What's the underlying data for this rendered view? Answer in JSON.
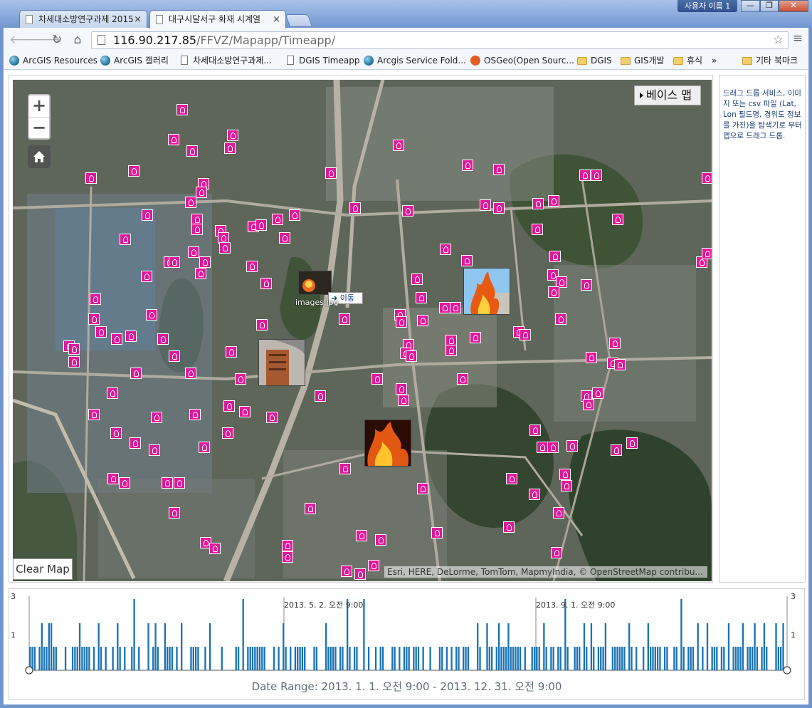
{
  "browser": {
    "tabs": [
      {
        "title": "차세대소방연구과제 2015"
      },
      {
        "title": "대구시달서구 화재 시계열"
      }
    ],
    "user_label": "사용자 이름 1",
    "window_buttons": [
      "—",
      "❐",
      "✕"
    ],
    "url_host": "116.90.217.85",
    "url_path": "/FFVZ/Mapapp/Timeapp/",
    "bookmarks": [
      {
        "label": "ArcGIS Resources",
        "icon": "globe-icon"
      },
      {
        "label": "ArcGIS 갤러리",
        "icon": "globe-icon"
      },
      {
        "label": "차세대소방연구과제...",
        "icon": "page-icon"
      },
      {
        "label": "DGIS Timeapp",
        "icon": "page-icon"
      },
      {
        "label": "Arcgis Service Fold...",
        "icon": "globe-icon"
      },
      {
        "label": "OSGeo(Open Sourc...",
        "icon": "osgeo-icon"
      },
      {
        "label": "DGIS",
        "icon": "folder-icon"
      },
      {
        "label": "GIS개발",
        "icon": "folder-icon"
      },
      {
        "label": "휴식",
        "icon": "folder-icon"
      }
    ],
    "bookmarks_overflow": "»",
    "other_bookmarks": "기타 북마크"
  },
  "map": {
    "zoom_in": "+",
    "zoom_out": "−",
    "basemap_label": "베이스 맵",
    "clear_label": "Clear Map",
    "attribution": "Esri, HERE, DeLorme, TomTom, MapmyIndia, © OpenStreetMap contribu...",
    "move_button": "➜ 이동",
    "image_label": "images.jpg",
    "colors": {
      "marker": "#e0199a",
      "bar": "#1a73b5"
    }
  },
  "side_panel": {
    "text": "드래그 드롭 서비스, 이미지 또는 csv 파일 (Lat, Lon 필드명, 경위도 정보를 가진)을 탐색기로 부터 맵으로 드래그 드롭."
  },
  "timeline": {
    "y_max_label": "3",
    "y_mid_label": "1",
    "markers": [
      "2013. 5. 2. 오전 9:00",
      "2013. 9. 1. 오전 9:00"
    ],
    "date_range": "Date Range: 2013. 1. 1. 오전 9:00 - 2013. 12. 31. 오전 9:00",
    "counts": [
      1,
      1,
      1,
      0,
      1,
      2,
      1,
      1,
      2,
      2,
      1,
      1,
      0,
      0,
      0,
      1,
      0,
      0,
      1,
      1,
      1,
      2,
      1,
      1,
      1,
      1,
      0,
      1,
      0,
      2,
      1,
      0,
      1,
      0,
      0,
      1,
      0,
      2,
      1,
      0,
      1,
      0,
      0,
      1,
      3,
      0,
      1,
      0,
      0,
      0,
      2,
      0,
      1,
      2,
      1,
      0,
      0,
      2,
      1,
      1,
      1,
      0,
      1,
      0,
      2,
      0,
      0,
      0,
      1,
      1,
      1,
      1,
      0,
      0,
      1,
      0,
      2,
      0,
      0,
      0,
      0,
      1,
      0,
      0,
      0,
      0,
      0,
      1,
      1,
      0,
      3,
      0,
      1,
      1,
      1,
      1,
      1,
      1,
      1,
      1,
      0,
      0,
      0,
      1,
      0,
      1,
      0,
      2,
      1,
      0,
      1,
      0,
      1,
      1,
      1,
      1,
      1,
      0,
      0,
      0,
      1,
      1,
      0,
      0,
      0,
      2,
      1,
      1,
      1,
      1,
      0,
      1,
      1,
      0,
      3,
      1,
      0,
      1,
      1,
      0,
      0,
      3,
      0,
      1,
      0,
      0,
      1,
      0,
      1,
      1,
      0,
      0,
      0,
      1,
      1,
      0,
      1,
      0,
      1,
      1,
      1,
      0,
      1,
      1,
      1,
      0,
      1,
      0,
      0,
      1,
      0,
      0,
      0,
      1,
      1,
      0,
      1,
      0,
      1,
      0,
      1,
      1,
      0,
      1,
      1,
      1,
      0,
      0,
      0,
      2,
      1,
      0,
      0,
      2,
      1,
      1,
      0,
      1,
      2,
      1,
      1,
      1,
      2,
      1,
      1,
      1,
      1,
      1,
      0,
      1,
      0,
      0,
      1,
      1,
      1,
      1,
      0,
      2,
      1,
      0,
      1,
      1,
      0,
      1,
      1,
      0,
      3,
      1,
      0,
      0,
      1,
      1,
      1,
      0,
      2,
      1,
      0,
      2,
      1,
      0,
      1,
      1,
      1,
      2,
      0,
      0,
      1,
      1,
      1,
      1,
      1,
      1,
      0,
      2,
      1,
      0,
      1,
      0,
      0,
      1,
      0,
      2,
      1,
      1,
      1,
      1,
      1,
      0,
      1,
      1,
      0,
      0,
      1,
      1,
      0,
      3,
      1,
      0,
      1,
      1,
      1,
      0,
      2,
      0,
      1,
      0,
      2,
      0,
      1,
      1,
      1,
      0,
      1,
      1,
      0,
      2,
      0,
      1,
      1,
      1,
      1,
      2,
      0,
      1,
      1,
      1,
      2,
      1,
      0,
      1,
      2,
      1,
      0,
      0,
      0,
      2,
      1,
      1,
      2,
      0
    ]
  }
}
